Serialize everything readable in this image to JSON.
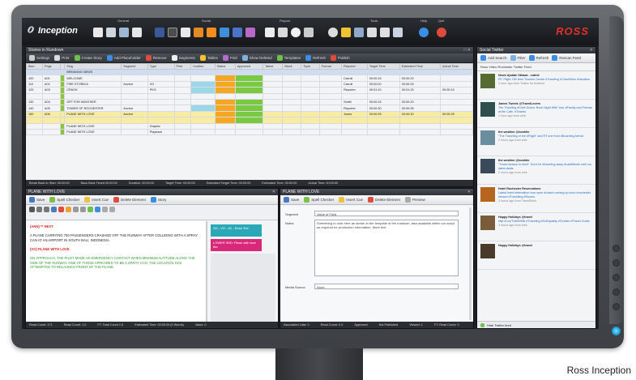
{
  "app": {
    "logo_text": "Inception",
    "brand": "ROSS",
    "toolbar_groups": [
      "General",
      "Social",
      "Playout",
      "Tools",
      "Help",
      "Quit"
    ]
  },
  "stories_panel": {
    "title": "Stories in Rundown",
    "toolbar": [
      "Settings",
      "Print",
      "Create Story",
      "Add Placeholder",
      "Remove",
      "Segments",
      "Tables",
      "Find",
      "Show Deleted",
      "Templates",
      "Refresh",
      "Publish"
    ],
    "columns": [
      "Item",
      "Page",
      "Slug",
      "Segment",
      "Type",
      "Print",
      "Confirm",
      "Status",
      "Approved",
      "Talent",
      "Block",
      "Topic",
      "Format",
      "Reporter",
      "Target Time",
      "Estimated Time",
      "Actual Time",
      "Notes"
    ],
    "rows": [
      {
        "item": "",
        "page": "",
        "slug": "BREAKING NEWS",
        "seg": "",
        "type": "",
        "rep": "",
        "target": "",
        "est": "",
        "actual": "",
        "style": "first"
      },
      {
        "item": "100",
        "page": "A01",
        "slug": "WELCOME",
        "seg": "",
        "type": "",
        "rep": "Carroll",
        "target": "00:00:15",
        "est": "00:00:20",
        "actual": "",
        "style": ""
      },
      {
        "item": "110",
        "page": "A02",
        "slug": "FIRE STORM A",
        "seg": "Anchor",
        "type": "VO",
        "rep": "Carroll",
        "target": "00:00:20",
        "est": "00:00:25",
        "actual": "",
        "style": ""
      },
      {
        "item": "120",
        "page": "A03",
        "slug": "CRASH",
        "seg": "",
        "type": "PKG",
        "rep": "Reporter",
        "target": "00:01:10",
        "est": "00:01:15",
        "actual": "00:00:10",
        "style": ""
      },
      {
        "item": "",
        "page": "",
        "slug": "",
        "seg": "",
        "type": "",
        "rep": "",
        "target": "",
        "est": "",
        "actual": "",
        "style": ""
      },
      {
        "item": "130",
        "page": "A04",
        "slug": "OFF FOR WEATHER",
        "seg": "",
        "type": "",
        "rep": "Smith",
        "target": "00:00:15",
        "est": "00:00:20",
        "actual": "",
        "style": ""
      },
      {
        "item": "140",
        "page": "A05",
        "slug": "TOWER OF ROCHESTER",
        "seg": "Anchor",
        "type": "",
        "rep": "Reporter",
        "target": "00:00:30",
        "est": "00:00:35",
        "actual": "",
        "style": ""
      },
      {
        "item": "150",
        "page": "A06",
        "slug": "PLANE WITH LOVE",
        "seg": "Anchor",
        "type": "",
        "rep": "Jones",
        "target": "00:00:25",
        "est": "00:00:30",
        "actual": "00:00:25",
        "style": "sel"
      },
      {
        "item": "",
        "page": "",
        "slug": "",
        "seg": "",
        "type": "",
        "rep": "",
        "target": "",
        "est": "",
        "actual": "",
        "style": "sel"
      },
      {
        "item": "",
        "page": "",
        "slug": "PLANE WITH LOVE",
        "seg": "",
        "type": "Graphic",
        "rep": "",
        "target": "",
        "est": "",
        "actual": "",
        "style": ""
      },
      {
        "item": "",
        "page": "",
        "slug": "PLANE WITH LOVE",
        "seg": "",
        "type": "Playback",
        "rep": "",
        "target": "",
        "est": "",
        "actual": "",
        "style": ""
      }
    ],
    "status_bar": [
      "Break Back to Start: 00:00:00",
      "Back Back Timed 00:00:00",
      "Duration: 00:00:00",
      "Target Time: 00:00:00",
      "Estimated Target Time: 00:00:00",
      "Estimated Time: 00:00:00",
      "Actual Time: 00:00:00"
    ]
  },
  "story_editor": {
    "title": "PLANE WITH LOVE",
    "toolbar": [
      "Save",
      "Spell Checker",
      "Insert Cue",
      "Delete Element",
      "Story"
    ],
    "heading": "(ANN) ** NEXT",
    "para1": "A PLANE CARRYING 750 PASSENGERS CRASHED OFF THE RUNWAY AFTER COLLIDING WITH A SPRAY CAN AT AN AIRPORT IN SOUTH BALI, INDONESIA.",
    "heading2": "(VO) PLANE WITH LOVE",
    "para2": "ON APPROACH, THE PILOT MADE AN EMERGENCY CONTACT WHEN MINIMUM ALTITUDE ALONG THE SIDE OF THE RUNWAY. ONE OF THOSE APPEARED TO BE A SPRAY CAN. THE LOCATION HAS ATTEMPTED TO RELAUNCH FRONT OF THE PLANE.",
    "cue1": "SH - VO - A2 - Rose 30e",
    "cue2": "LOWER 3RD: Plane with love fire",
    "status_bar": [
      "Read Count: 171",
      "Read Count: 1.0",
      "FT: Total Count 1.5",
      "Estimated Time: 00:00:25 (0 Words)",
      "Value: 0"
    ]
  },
  "details_panel": {
    "title": "PLANE WITH LOVE",
    "toolbar": [
      "Save",
      "Spell Checker",
      "Insert Cue",
      "Delete Element",
      "Preview",
      "Story"
    ],
    "field1_label": "Segment",
    "field1_value": "Value of Field",
    "field2_label": "Notes",
    "field2_value": "Something to note here as shown in the template of the rundown, also available within our script as required for production information. More text.",
    "field3_label": "Media Source",
    "field3_value": "None",
    "status_bar": [
      "Associated Lists: 0",
      "Read Count: 0.0",
      "Approved",
      "Not Published",
      "Viewed: 1",
      "FT: Read Count: 0"
    ]
  },
  "social_panel": {
    "title": "Social Twitter",
    "toolbar": [
      "Add Search",
      "Filter",
      "Refresh",
      "Rescan Feed"
    ],
    "header": "Ross Video Rochester Twitter Feed",
    "tweets": [
      {
        "user": "News Update Ottawa - Latest",
        "text": "RT: Flight 750 from Tourism Centre #Traveling #ClearSkies #Vacation",
        "meta": "1 hour ago from Twitter for Android"
      },
      {
        "user": "James Tweets @TravelLovers",
        "text": "The Traveling #Chef-Grand. Book Night With Your #Family and Friends at the Cafe. #Travels",
        "meta": "1 hour ago from web"
      },
      {
        "user": "the weather @tomhite",
        "text": "\"The Traveling of the #Flight\" and RT one from #Boarding Arrival",
        "meta": "2 hours ago from web"
      },
      {
        "user": "the weather @tomhite",
        "text": "\"Travel season is here!\" Don't be #traveling away #LastMinute with our latest deals",
        "meta": "2 hours ago from web"
      },
      {
        "user": "Hotel Rochester Reservations",
        "text": "Latest hotel reservation now open #rocket coming up soon #rochester #resort #Travelling #Rooms",
        "meta": "3 hours ago from TweetDeck"
      },
      {
        "user": "Happy Holidays @travel",
        "text": "http://t.co/TnMtVWfk #Traveling #GoEquality #Tourism #Travel Guide",
        "meta": "3 hours ago from web"
      },
      {
        "user": "Happy Holidays @travel",
        "text": "",
        "meta": ""
      }
    ],
    "footer": "Hide Twitter feed"
  },
  "caption": "Ross Inception",
  "colors": {
    "accent_red": "#e3302a",
    "status_orange": "#f5a623",
    "status_green": "#7ac943",
    "selected_row": "#f8eca2",
    "cue_teal": "#2aa8b8",
    "cue_magenta": "#d9287a"
  }
}
